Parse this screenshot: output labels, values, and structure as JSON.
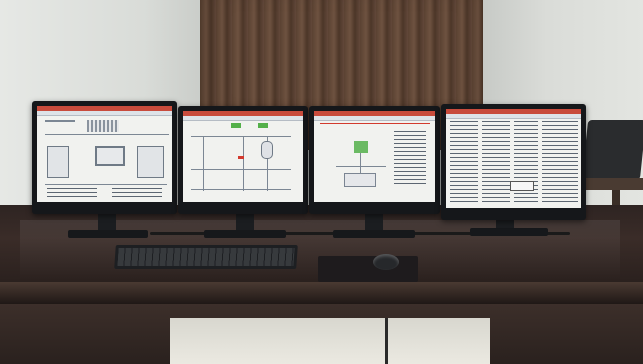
{
  "scene": {
    "description_tags": [
      "control-room",
      "four-monitors",
      "keyboard",
      "mouse",
      "curtain",
      "table"
    ]
  },
  "monitors": [
    {
      "name": "monitor-1"
    },
    {
      "name": "monitor-2"
    },
    {
      "name": "monitor-3"
    },
    {
      "name": "monitor-4"
    }
  ],
  "colors": {
    "curtain": "#5a4232",
    "table": "#2e2422",
    "bezel": "#15171a",
    "screen_bg": "#f1f2ef",
    "window_title": "#c84b3c",
    "highlight_green": "#54b04a",
    "alarm_red": "#d23a2e"
  }
}
